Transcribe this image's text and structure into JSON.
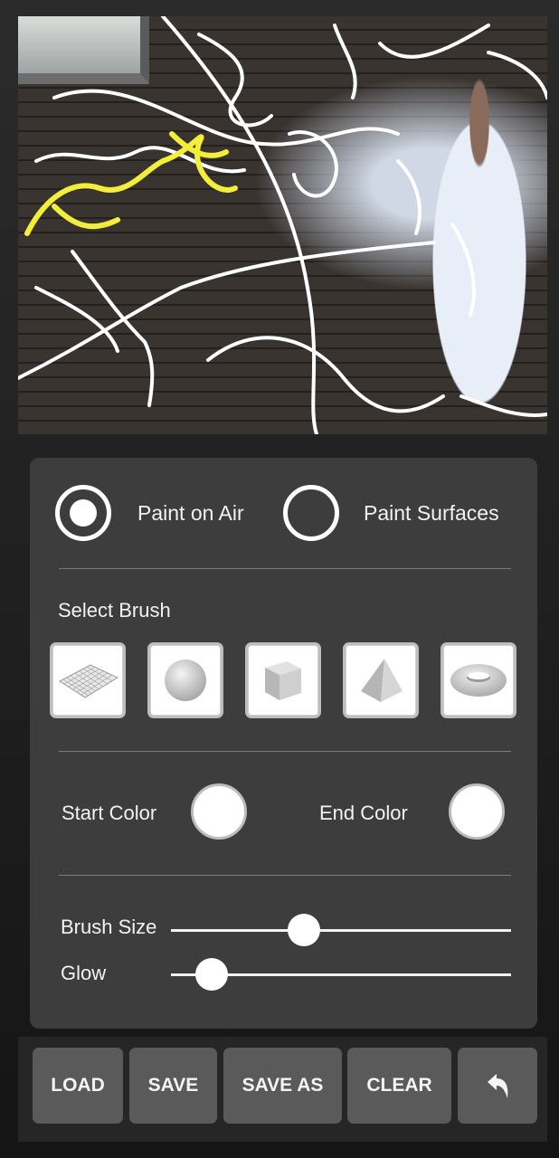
{
  "mode": {
    "options": [
      {
        "label": "Paint on Air",
        "selected": true
      },
      {
        "label": "Paint Surfaces",
        "selected": false
      }
    ]
  },
  "brush": {
    "section_label": "Select Brush",
    "items": [
      {
        "icon": "grid-plane-icon"
      },
      {
        "icon": "sphere-icon"
      },
      {
        "icon": "cube-icon"
      },
      {
        "icon": "pyramid-icon"
      },
      {
        "icon": "torus-icon"
      }
    ]
  },
  "colors": {
    "start_label": "Start Color",
    "start_value": "#ffffff",
    "end_label": "End Color",
    "end_value": "#ffffff"
  },
  "sliders": {
    "brush_size": {
      "label": "Brush Size",
      "value": 0.38
    },
    "glow": {
      "label": "Glow",
      "value": 0.08
    }
  },
  "toolbar": {
    "load_label": "LOAD",
    "save_label": "SAVE",
    "save_as_label": "SAVE AS",
    "clear_label": "CLEAR",
    "undo_icon": "undo-icon"
  },
  "camera_view": {
    "overlay_colors": [
      "#ffffff",
      "#f2ee3a"
    ]
  }
}
